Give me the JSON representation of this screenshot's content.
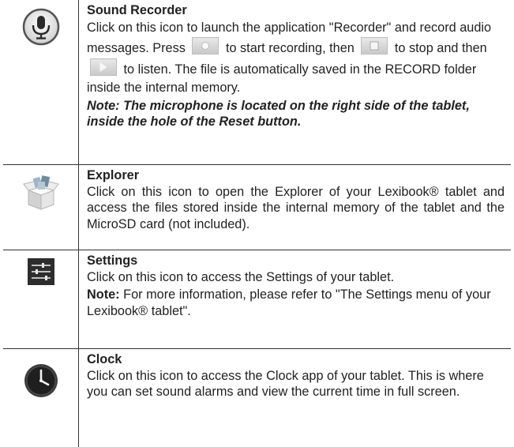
{
  "rows": [
    {
      "icon": "microphone-icon",
      "title": "Sound Recorder",
      "body_1": "Click on this icon to launch the application \"Recorder\" and record audio messages. Press",
      "body_2": "to start recording, then",
      "body_3": "to stop and then",
      "body_4": "to listen. The file is automatically saved in the RECORD folder inside the internal memory.",
      "note": "Note: The microphone is located on the right side of the tablet, inside the hole of the Reset button."
    },
    {
      "icon": "explorer-box-icon",
      "title": "Explorer",
      "body": "Click on this icon to open the Explorer of your Lexibook® tablet and access the files stored inside the internal memory of the tablet and the MicroSD card (not included)."
    },
    {
      "icon": "settings-sliders-icon",
      "title": "Settings",
      "body": "Click on this icon to access the Settings of your tablet.",
      "note_label": "Note:",
      "note_text": "For more information, please refer to \"The Settings menu of your Lexibook® tablet\"."
    },
    {
      "icon": "clock-icon",
      "title": "Clock",
      "body": "Click on this icon to access the Clock app of your tablet. This is where you can set sound alarms and view the current time in full screen."
    }
  ]
}
